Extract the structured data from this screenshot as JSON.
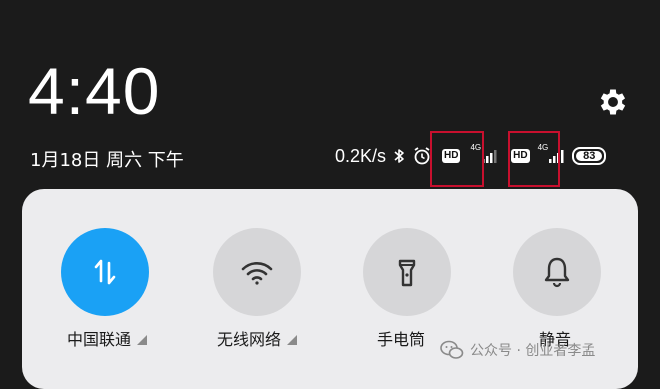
{
  "lockscreen": {
    "time": "4:40",
    "date": "1月18日 周六 下午"
  },
  "status_bar": {
    "network_speed": "0.2K/s",
    "icons": [
      "bluetooth-icon",
      "alarm-icon",
      "hd-icon",
      "signal-icon",
      "hd-icon",
      "signal-icon"
    ],
    "hd_label": "HD",
    "network_type": "4G",
    "battery_level": "83",
    "battery_fraction": 0.83
  },
  "quick_settings": {
    "tiles": [
      {
        "label": "中国联通",
        "icon": "mobile-data-icon",
        "active": true,
        "has_dropdown": true
      },
      {
        "label": "无线网络",
        "icon": "wifi-icon",
        "active": false,
        "has_dropdown": true
      },
      {
        "label": "手电筒",
        "icon": "flashlight-icon",
        "active": false,
        "has_dropdown": false
      },
      {
        "label": "静音",
        "icon": "bell-icon",
        "active": false,
        "has_dropdown": false
      }
    ]
  },
  "watermark": {
    "text": "公众号 · 创业者李孟"
  },
  "colors": {
    "background": "#1b1b1b",
    "panel": "#ececee",
    "active_tile": "#1aa1f5",
    "inactive_tile": "#d6d6d8",
    "highlight_box": "#c8102e"
  }
}
